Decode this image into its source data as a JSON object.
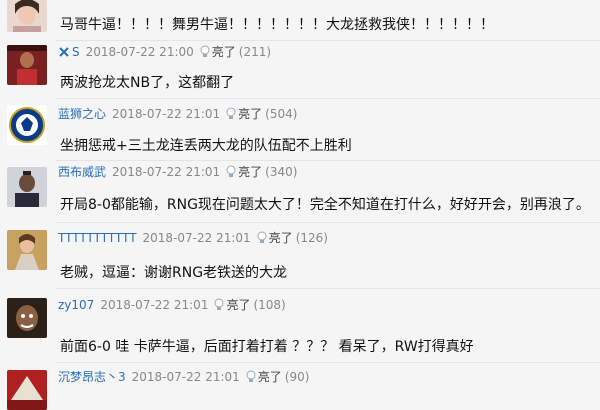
{
  "comments": [
    {
      "text": "马哥牛逼！！！！舞男牛逼！！！！！！！大龙拯救我侠！！！！！！"
    },
    {
      "user": "S",
      "time": "2018-07-22 21:00",
      "like_label": "亮了",
      "count": "(211)",
      "text": "两波抢龙太NB了，这都翻了"
    },
    {
      "user": "蓝狮之心",
      "time": "2018-07-22 21:01",
      "like_label": "亮了",
      "count": "(504)",
      "text": "坐拥惩戒+三土龙连丢两大龙的队伍配不上胜利"
    },
    {
      "user": "西布威武",
      "time": "2018-07-22 21:01",
      "like_label": "亮了",
      "count": "(340)",
      "text": "开局8-0都能输，RNG现在问题太大了！完全不知道在打什么，好好开会，别再浪了。"
    },
    {
      "user": "TTTTTTTTTTT",
      "time": "2018-07-22 21:01",
      "like_label": "亮了",
      "count": "(126)",
      "text": "老贼，逗逼：谢谢RNG老铁送的大龙"
    },
    {
      "user": "zy107",
      "time": "2018-07-22 21:01",
      "like_label": "亮了",
      "count": "(108)",
      "text": "前面6-0 哇 卡萨牛逼，后面打着打着 ？？？ 看呆了，RW打得真好"
    },
    {
      "user": "沉梦昂志丶3",
      "time": "2018-07-22 21:01",
      "like_label": "亮了",
      "count": "(90)"
    }
  ],
  "colors": {
    "username": "#2a6fb8",
    "meta": "#888888",
    "background": "#f5f5f5"
  },
  "icons": [
    "lightbulb-icon",
    "user-badge-icon"
  ]
}
